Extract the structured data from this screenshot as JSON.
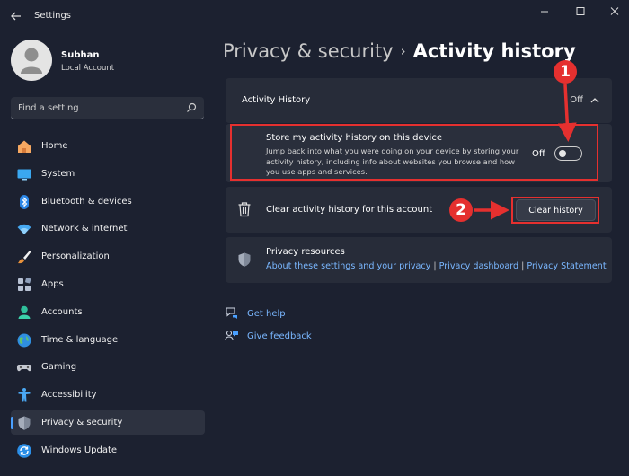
{
  "window": {
    "title": "Settings"
  },
  "profile": {
    "name": "Subhan",
    "account_type": "Local Account"
  },
  "search": {
    "placeholder": "Find a setting"
  },
  "sidebar": {
    "items": [
      {
        "label": "Home",
        "icon": "home-icon"
      },
      {
        "label": "System",
        "icon": "monitor-icon"
      },
      {
        "label": "Bluetooth & devices",
        "icon": "bluetooth-icon"
      },
      {
        "label": "Network & internet",
        "icon": "wifi-icon"
      },
      {
        "label": "Personalization",
        "icon": "brush-icon"
      },
      {
        "label": "Apps",
        "icon": "apps-icon"
      },
      {
        "label": "Accounts",
        "icon": "person-icon"
      },
      {
        "label": "Time & language",
        "icon": "globe-icon"
      },
      {
        "label": "Gaming",
        "icon": "gamepad-icon"
      },
      {
        "label": "Accessibility",
        "icon": "accessibility-icon"
      },
      {
        "label": "Privacy & security",
        "icon": "shield-icon",
        "active": true
      },
      {
        "label": "Windows Update",
        "icon": "update-icon"
      }
    ]
  },
  "breadcrumb": {
    "parent": "Privacy & security",
    "separator": "›",
    "current": "Activity history"
  },
  "activity_history": {
    "header_title": "Activity History",
    "header_status": "Off",
    "store": {
      "title": "Store my activity history on this device",
      "description": "Jump back into what you were doing on your device by storing your activity history, including info about websites you browse and how you use apps and services.",
      "toggle_label": "Off",
      "toggle_on": false
    },
    "clear": {
      "text": "Clear activity history for this account",
      "button_label": "Clear history"
    },
    "privacy": {
      "title": "Privacy resources",
      "links": [
        "About these settings and your privacy",
        "Privacy dashboard",
        "Privacy Statement"
      ]
    }
  },
  "help": {
    "get_help": "Get help",
    "give_feedback": "Give feedback"
  },
  "annotations": {
    "step1": "1",
    "step2": "2",
    "color": "#e5302f"
  },
  "colors": {
    "background": "#1c2130",
    "card": "#272c39",
    "accent": "#4aa0ff",
    "link": "#7ab7ff"
  }
}
